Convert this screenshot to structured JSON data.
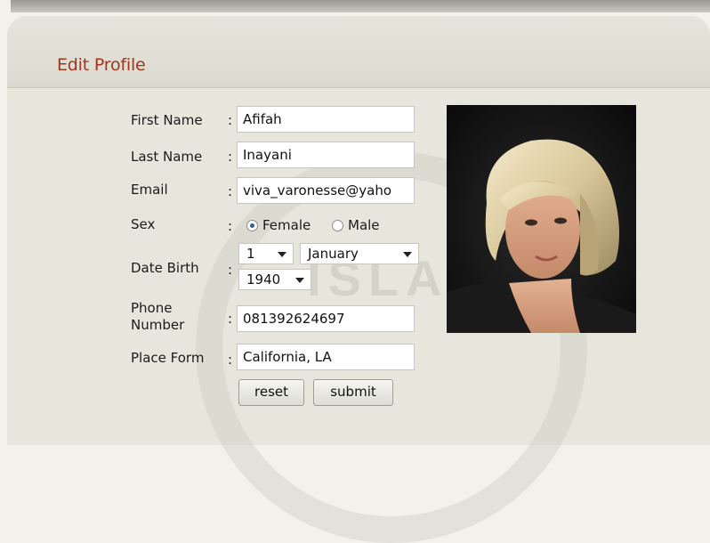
{
  "panel": {
    "title": "Edit Profile"
  },
  "form": {
    "first_name": {
      "label": "First Name",
      "value": "Afifah"
    },
    "last_name": {
      "label": "Last Name",
      "value": "Inayani"
    },
    "email": {
      "label": "Email",
      "value": "viva_varonesse@yaho"
    },
    "sex": {
      "label": "Sex",
      "options": [
        "Female",
        "Male"
      ],
      "selected": "Female"
    },
    "date_birth": {
      "label": "Date Birth",
      "day": "1",
      "month": "January",
      "year": "1940"
    },
    "phone": {
      "label_line1": "Phone",
      "label_line2": "Number",
      "value": "081392624697"
    },
    "place_form": {
      "label": "Place Form",
      "value": "California, LA"
    },
    "colon": ":",
    "buttons": {
      "reset": "reset",
      "submit": "submit"
    }
  },
  "watermark": {
    "text": "ISLAM"
  },
  "colors": {
    "title": "#a3341c",
    "panel": "#e7e6dd",
    "radio_checked": "#2b5ea8"
  }
}
